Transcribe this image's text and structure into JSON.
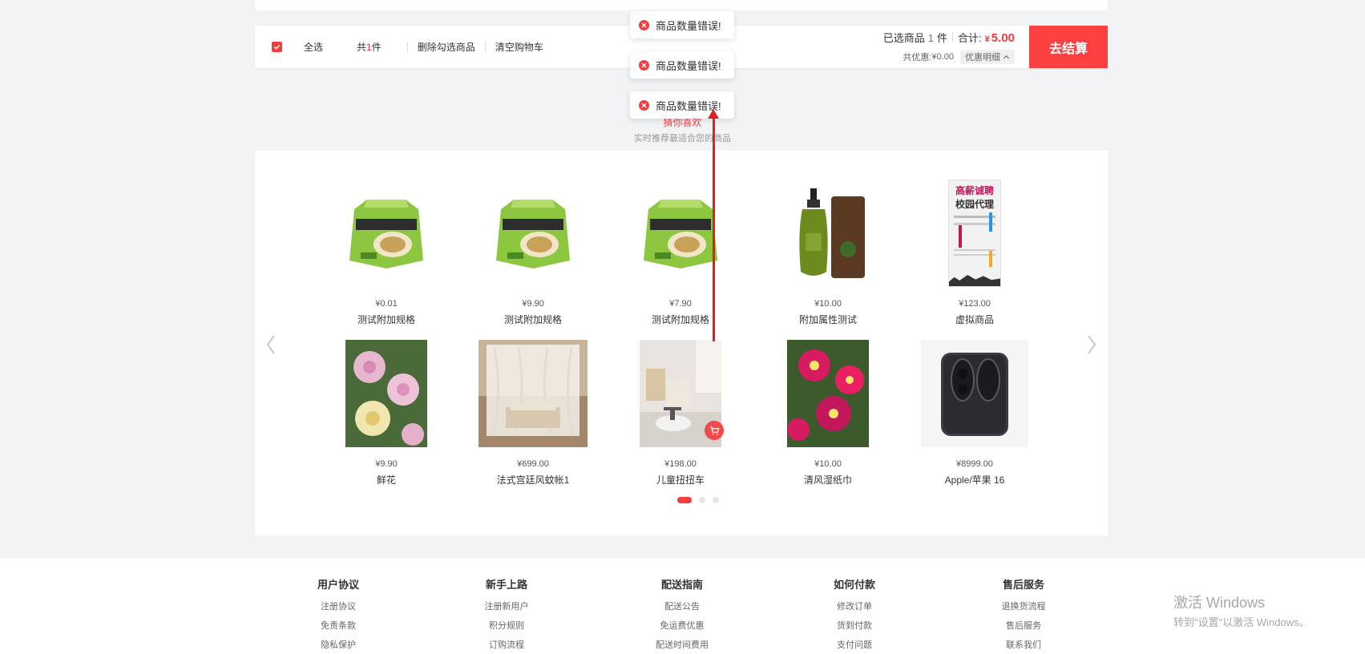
{
  "cart_bar": {
    "select_all": "全选",
    "total_prefix": "共",
    "total_count": "1",
    "total_suffix": "件",
    "delete_selected": "删除勾选商品",
    "clear_cart": "清空购物车",
    "selected_prefix": "已选商品",
    "selected_count": "1",
    "selected_suffix": "件",
    "total_label": "合计:",
    "currency": "¥",
    "total_price": "5.00",
    "discount_label": "共优惠:",
    "discount_value": "¥0.00",
    "discount_detail": "优惠明细",
    "checkout": "去结算"
  },
  "toasts": [
    "商品数量错误!",
    "商品数量错误!",
    "商品数量错误!"
  ],
  "recommend": {
    "title": "猜你喜欢",
    "subtitle": "实时推荐最适合您的商品",
    "products": [
      {
        "price": "¥0.01",
        "name": "测试附加规格",
        "image": "instant-noodle-pack"
      },
      {
        "price": "¥9.90",
        "name": "测试附加规格",
        "image": "instant-noodle-pack"
      },
      {
        "price": "¥7.90",
        "name": "测试附加规格",
        "image": "instant-noodle-pack"
      },
      {
        "price": "¥10.00",
        "name": "附加属性测试",
        "image": "shampoo-bottle"
      },
      {
        "price": "¥123.00",
        "name": "虚拟商品",
        "image": "campus-poster"
      },
      {
        "price": "¥9.90",
        "name": "鲜花",
        "image": "pink-chrysanthemum"
      },
      {
        "price": "¥699.00",
        "name": "法式宫廷风蚊帐1",
        "image": "canopy-bed"
      },
      {
        "price": "¥198.00",
        "name": "儿童扭扭车",
        "image": "kids-room"
      },
      {
        "price": "¥10.00",
        "name": "清风湿纸巾",
        "image": "magenta-flowers"
      },
      {
        "price": "¥8999.00",
        "name": "Apple/苹果 16",
        "image": "iphone"
      }
    ],
    "poster_text": {
      "line1": "高薪诚聘",
      "line2": "校园代理"
    }
  },
  "footer": {
    "columns": [
      {
        "title": "用户协议",
        "links": [
          "注册协议",
          "免责条款",
          "隐私保护"
        ]
      },
      {
        "title": "新手上路",
        "links": [
          "注册新用户",
          "积分规则",
          "订购流程"
        ]
      },
      {
        "title": "配送指南",
        "links": [
          "配送公告",
          "免运费优惠",
          "配送时间费用"
        ]
      },
      {
        "title": "如何付款",
        "links": [
          "修改订单",
          "货到付款",
          "支付问题"
        ]
      },
      {
        "title": "售后服务",
        "links": [
          "退换货流程",
          "售后服务",
          "联系我们"
        ]
      }
    ]
  },
  "watermark": {
    "line1": "激活 Windows",
    "line2": "转到\"设置\"以激活 Windows。"
  },
  "colors": {
    "accent": "#f23d3d",
    "checkout_bg": "#fd4040"
  }
}
